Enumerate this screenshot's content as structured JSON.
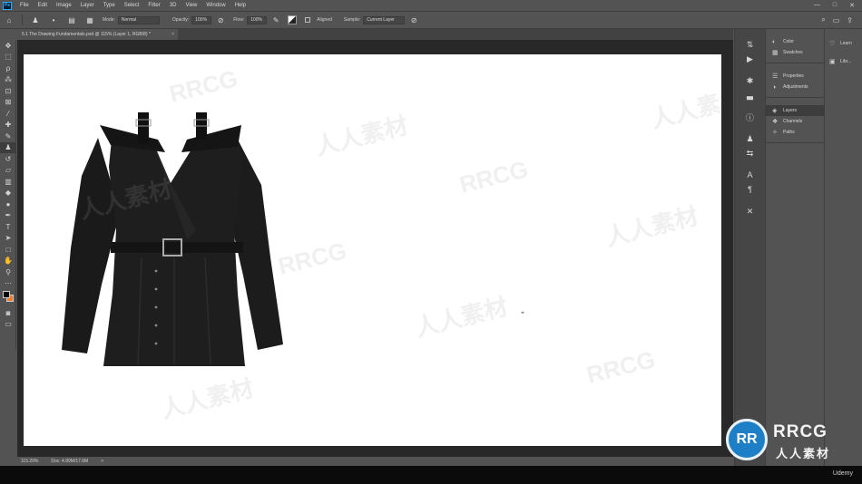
{
  "app": {
    "logo": "Ps",
    "tint": "#31a8ff"
  },
  "menu": [
    "File",
    "Edit",
    "Image",
    "Layer",
    "Type",
    "Select",
    "Filter",
    "3D",
    "View",
    "Window",
    "Help"
  ],
  "window_controls": [
    "—",
    "□",
    "✕"
  ],
  "options": {
    "mode_label": "Mode:",
    "mode_value": "Normal",
    "opacity_label": "Opacity:",
    "opacity_value": "100%",
    "flow_label": "Flow:",
    "flow_value": "100%",
    "aligned_label": "Aligned",
    "sample_label": "Sample:",
    "sample_value": "Current Layer"
  },
  "document_tab": {
    "title": "5.1 The Drawing Fundamentals.psd @ 115% (Layer 1, RGB/8) *",
    "close": "×"
  },
  "canvas": {
    "background": "#ffffff",
    "cursor": "⌖"
  },
  "colors": {
    "foreground": "#000000",
    "background": "#ed7c2f"
  },
  "status": {
    "zoom": "115.29%",
    "doc": "Doc: 4.89M/17.6M",
    "arrow": ">"
  },
  "right_panels": {
    "group1": [
      "Color",
      "Swatches"
    ],
    "group2": [
      "Properties",
      "Adjustments"
    ],
    "group3": [
      "Layers",
      "Channels",
      "Paths"
    ],
    "libraries": [
      "Learn",
      "Libr..."
    ]
  },
  "footer": {
    "udemy": "Udemy"
  },
  "watermark": {
    "brand": "RRCG",
    "cn": "人人素材",
    "logo_letters": "RR"
  }
}
